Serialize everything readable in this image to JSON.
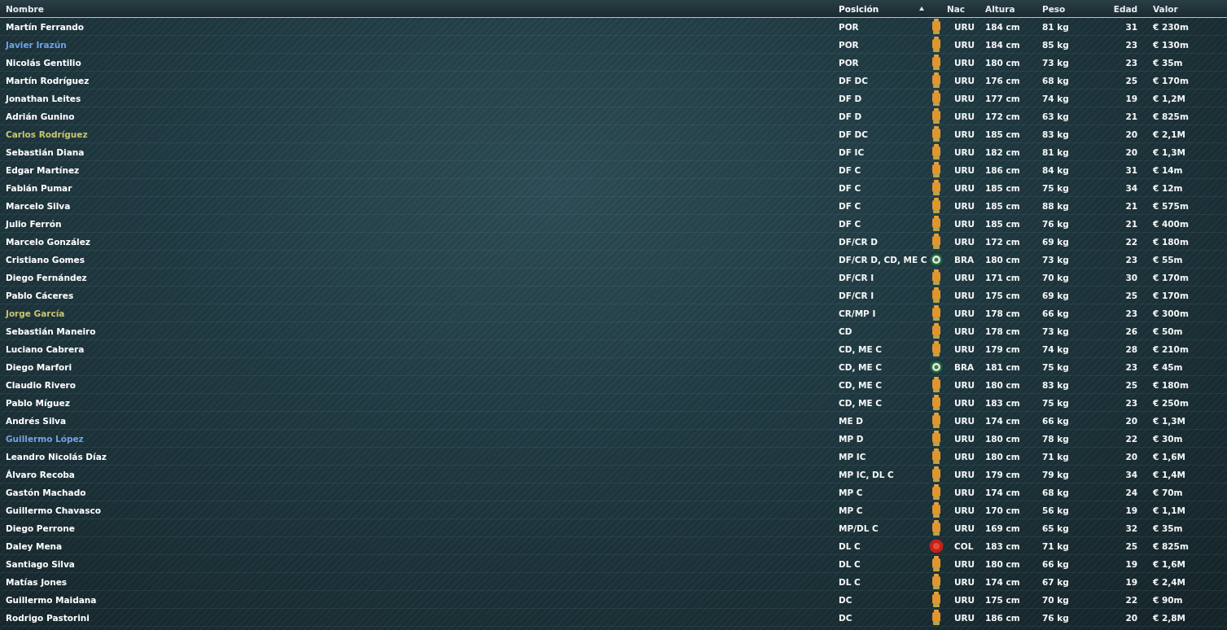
{
  "table": {
    "columns": [
      {
        "label": "Nombre",
        "sorted": false
      },
      {
        "label": "Posición",
        "sorted": true
      },
      {
        "label": "Nac",
        "sorted": false
      },
      {
        "label": "Altura",
        "sorted": false
      },
      {
        "label": "Peso",
        "sorted": false
      },
      {
        "label": "Edad",
        "sorted": false
      },
      {
        "label": "Valor",
        "sorted": false
      }
    ],
    "rows": [
      {
        "name": "Martín Ferrando",
        "color": "#ffffff",
        "position": "POR",
        "kind": "uruguay",
        "nat": "URU",
        "height": "184 cm",
        "weight": "81 kg",
        "age": "31",
        "value": "€ 230m"
      },
      {
        "name": "Javier Irazún",
        "color": "#6fa3e6",
        "position": "POR",
        "kind": "uruguay",
        "nat": "URU",
        "height": "184 cm",
        "weight": "85 kg",
        "age": "23",
        "value": "€ 130m"
      },
      {
        "name": "Nicolás Gentilio",
        "color": "#ffffff",
        "position": "POR",
        "kind": "uruguay",
        "nat": "URU",
        "height": "180 cm",
        "weight": "73 kg",
        "age": "23",
        "value": "€ 35m"
      },
      {
        "name": "Martín Rodríguez",
        "color": "#ffffff",
        "position": "DF DC",
        "kind": "uruguay",
        "nat": "URU",
        "height": "176 cm",
        "weight": "68 kg",
        "age": "25",
        "value": "€ 170m"
      },
      {
        "name": "Jonathan Leites",
        "color": "#ffffff",
        "position": "DF D",
        "kind": "uruguay",
        "nat": "URU",
        "height": "177 cm",
        "weight": "74 kg",
        "age": "19",
        "value": "€ 1,2M"
      },
      {
        "name": "Adrián Gunino",
        "color": "#ffffff",
        "position": "DF D",
        "kind": "uruguay",
        "nat": "URU",
        "height": "172 cm",
        "weight": "63 kg",
        "age": "21",
        "value": "€ 825m"
      },
      {
        "name": "Carlos Rodríguez",
        "color": "#c9c46e",
        "position": "DF DC",
        "kind": "uruguay",
        "nat": "URU",
        "height": "185 cm",
        "weight": "83 kg",
        "age": "20",
        "value": "€ 2,1M"
      },
      {
        "name": "Sebastián Diana",
        "color": "#ffffff",
        "position": "DF IC",
        "kind": "uruguay",
        "nat": "URU",
        "height": "182 cm",
        "weight": "81 kg",
        "age": "20",
        "value": "€ 1,3M"
      },
      {
        "name": "Edgar Martínez",
        "color": "#ffffff",
        "position": "DF C",
        "kind": "uruguay",
        "nat": "URU",
        "height": "186 cm",
        "weight": "84 kg",
        "age": "31",
        "value": "€ 14m"
      },
      {
        "name": "Fabián Pumar",
        "color": "#ffffff",
        "position": "DF C",
        "kind": "uruguay",
        "nat": "URU",
        "height": "185 cm",
        "weight": "75 kg",
        "age": "34",
        "value": "€ 12m"
      },
      {
        "name": "Marcelo Silva",
        "color": "#ffffff",
        "position": "DF C",
        "kind": "uruguay",
        "nat": "URU",
        "height": "185 cm",
        "weight": "88 kg",
        "age": "21",
        "value": "€ 575m"
      },
      {
        "name": "Julio Ferrón",
        "color": "#ffffff",
        "position": "DF C",
        "kind": "uruguay",
        "nat": "URU",
        "height": "185 cm",
        "weight": "76 kg",
        "age": "21",
        "value": "€ 400m"
      },
      {
        "name": "Marcelo González",
        "color": "#ffffff",
        "position": "DF/CR D",
        "kind": "uruguay",
        "nat": "URU",
        "height": "172 cm",
        "weight": "69 kg",
        "age": "22",
        "value": "€ 180m"
      },
      {
        "name": "Cristiano Gomes",
        "color": "#ffffff",
        "position": "DF/CR D, CD, ME C",
        "kind": "brazil",
        "nat": "BRA",
        "height": "180 cm",
        "weight": "73 kg",
        "age": "23",
        "value": "€ 55m"
      },
      {
        "name": "Diego Fernández",
        "color": "#ffffff",
        "position": "DF/CR I",
        "kind": "uruguay",
        "nat": "URU",
        "height": "171 cm",
        "weight": "70 kg",
        "age": "30",
        "value": "€ 170m"
      },
      {
        "name": "Pablo Cáceres",
        "color": "#ffffff",
        "position": "DF/CR I",
        "kind": "uruguay",
        "nat": "URU",
        "height": "175 cm",
        "weight": "69 kg",
        "age": "25",
        "value": "€ 170m"
      },
      {
        "name": "Jorge García",
        "color": "#c9c46e",
        "position": "CR/MP I",
        "kind": "uruguay",
        "nat": "URU",
        "height": "178 cm",
        "weight": "66 kg",
        "age": "23",
        "value": "€ 300m"
      },
      {
        "name": "Sebastián Maneiro",
        "color": "#ffffff",
        "position": "CD",
        "kind": "uruguay",
        "nat": "URU",
        "height": "178 cm",
        "weight": "73 kg",
        "age": "26",
        "value": "€ 50m"
      },
      {
        "name": "Luciano Cabrera",
        "color": "#ffffff",
        "position": "CD, ME C",
        "kind": "uruguay",
        "nat": "URU",
        "height": "179 cm",
        "weight": "74 kg",
        "age": "28",
        "value": "€ 210m"
      },
      {
        "name": "Diego Marfori",
        "color": "#ffffff",
        "position": "CD, ME C",
        "kind": "brazil",
        "nat": "BRA",
        "height": "181 cm",
        "weight": "75 kg",
        "age": "23",
        "value": "€ 45m"
      },
      {
        "name": "Claudio Rivero",
        "color": "#ffffff",
        "position": "CD, ME C",
        "kind": "uruguay",
        "nat": "URU",
        "height": "180 cm",
        "weight": "83 kg",
        "age": "25",
        "value": "€ 180m"
      },
      {
        "name": "Pablo Míguez",
        "color": "#ffffff",
        "position": "CD, ME C",
        "kind": "uruguay",
        "nat": "URU",
        "height": "183 cm",
        "weight": "75 kg",
        "age": "23",
        "value": "€ 250m"
      },
      {
        "name": "Andrés Silva",
        "color": "#ffffff",
        "position": "ME D",
        "kind": "uruguay",
        "nat": "URU",
        "height": "174 cm",
        "weight": "66 kg",
        "age": "20",
        "value": "€ 1,3M"
      },
      {
        "name": "Guillermo López",
        "color": "#6fa3e6",
        "position": "MP D",
        "kind": "uruguay",
        "nat": "URU",
        "height": "180 cm",
        "weight": "78 kg",
        "age": "22",
        "value": "€ 30m"
      },
      {
        "name": "Leandro Nicolás Díaz",
        "color": "#ffffff",
        "position": "MP IC",
        "kind": "uruguay",
        "nat": "URU",
        "height": "180 cm",
        "weight": "71 kg",
        "age": "20",
        "value": "€ 1,6M"
      },
      {
        "name": "Álvaro Recoba",
        "color": "#ffffff",
        "position": "MP IC, DL C",
        "kind": "uruguay",
        "nat": "URU",
        "height": "179 cm",
        "weight": "79 kg",
        "age": "34",
        "value": "€ 1,4M"
      },
      {
        "name": "Gastón Machado",
        "color": "#ffffff",
        "position": "MP C",
        "kind": "uruguay",
        "nat": "URU",
        "height": "174 cm",
        "weight": "68 kg",
        "age": "24",
        "value": "€ 70m"
      },
      {
        "name": "Guillermo Chavasco",
        "color": "#ffffff",
        "position": "MP C",
        "kind": "uruguay",
        "nat": "URU",
        "height": "170 cm",
        "weight": "56 kg",
        "age": "19",
        "value": "€ 1,1M"
      },
      {
        "name": "Diego Perrone",
        "color": "#ffffff",
        "position": "MP/DL C",
        "kind": "uruguay",
        "nat": "URU",
        "height": "169 cm",
        "weight": "65 kg",
        "age": "32",
        "value": "€ 35m"
      },
      {
        "name": "Daley Mena",
        "color": "#ffffff",
        "position": "DL C",
        "kind": "colombia",
        "nat": "COL",
        "height": "183 cm",
        "weight": "71 kg",
        "age": "25",
        "value": "€ 825m"
      },
      {
        "name": "Santiago Silva",
        "color": "#ffffff",
        "position": "DL C",
        "kind": "uruguay",
        "nat": "URU",
        "height": "180 cm",
        "weight": "66 kg",
        "age": "19",
        "value": "€ 1,6M"
      },
      {
        "name": "Matías Jones",
        "color": "#ffffff",
        "position": "DL C",
        "kind": "uruguay",
        "nat": "URU",
        "height": "174 cm",
        "weight": "67 kg",
        "age": "19",
        "value": "€ 2,4M"
      },
      {
        "name": "Guillermo Maidana",
        "color": "#ffffff",
        "position": "DC",
        "kind": "uruguay",
        "nat": "URU",
        "height": "175 cm",
        "weight": "70 kg",
        "age": "22",
        "value": "€ 90m"
      },
      {
        "name": "Rodrigo Pastorini",
        "color": "#ffffff",
        "position": "DC",
        "kind": "uruguay",
        "nat": "URU",
        "height": "186 cm",
        "weight": "76 kg",
        "age": "20",
        "value": "€ 2,8M"
      }
    ]
  }
}
